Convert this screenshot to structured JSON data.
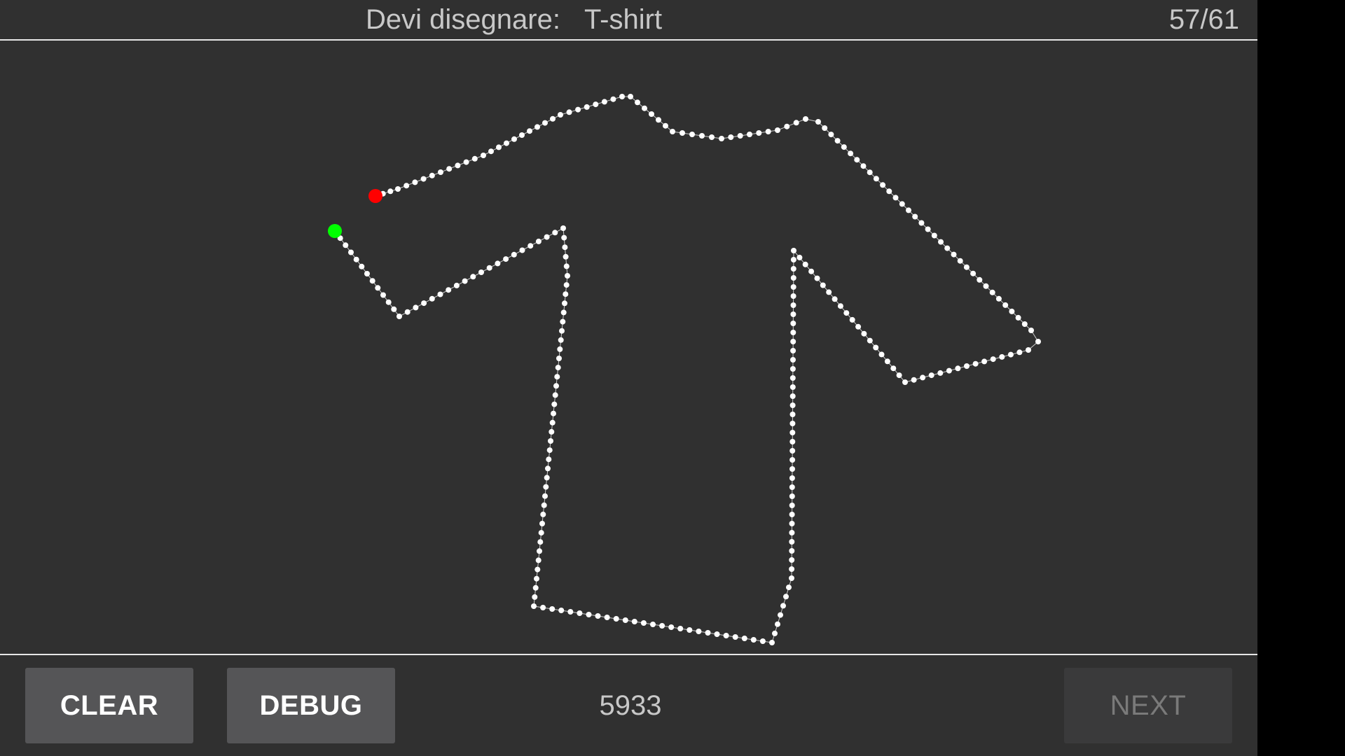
{
  "header": {
    "prompt_label": "Devi disegnare:",
    "target_word": "T-shirt",
    "progress": "57/61"
  },
  "drawing": {
    "stroke_color": "#ffffff",
    "start_marker_color": "#00ff00",
    "end_marker_color": "#ff0000"
  },
  "footer": {
    "clear_label": "CLEAR",
    "debug_label": "DEBUG",
    "score": "5933",
    "next_label": "NEXT"
  }
}
